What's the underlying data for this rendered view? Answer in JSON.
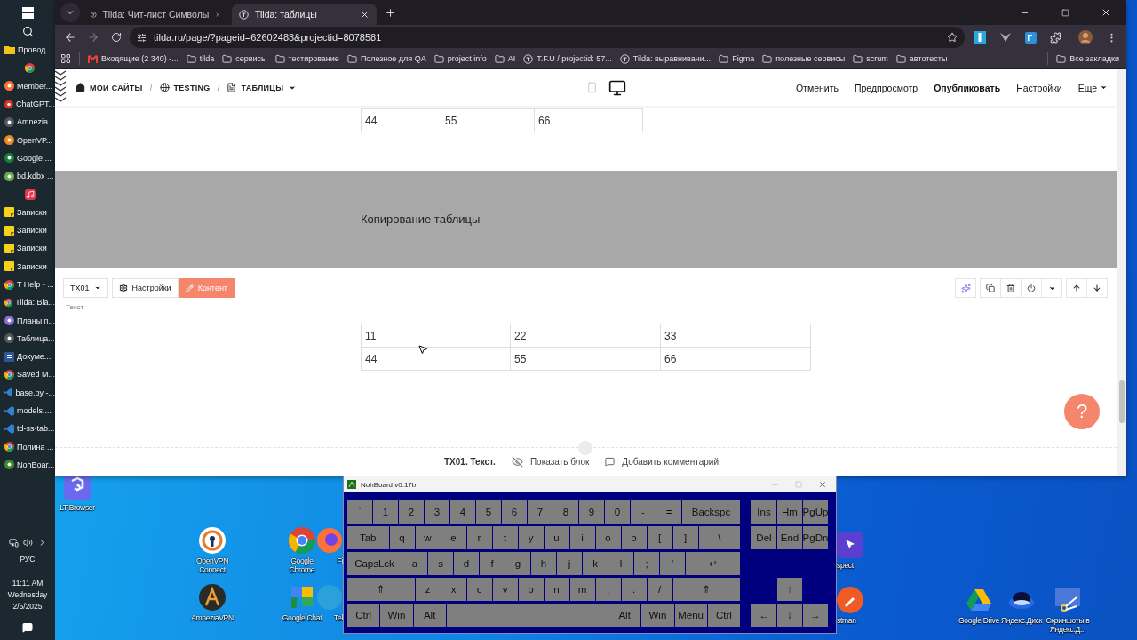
{
  "taskbar": {
    "items": [
      {
        "label": "Провод...",
        "kind": "folder"
      },
      {
        "kind": "chrome"
      },
      {
        "label": "Member...",
        "kind": "firefox"
      },
      {
        "label": "ChatGPT...",
        "kind": "red"
      },
      {
        "label": "Amnezia...",
        "kind": "dark"
      },
      {
        "label": "OpenVP...",
        "kind": "openvpn"
      },
      {
        "label": "Google ...",
        "kind": "green"
      },
      {
        "label": "bd.kdbx ...",
        "kind": "keepass"
      },
      {
        "kind": "music"
      },
      {
        "label": "Записки",
        "kind": "note"
      },
      {
        "label": "Записки",
        "kind": "note"
      },
      {
        "label": "Записки",
        "kind": "note"
      },
      {
        "label": "Записки",
        "kind": "note"
      },
      {
        "label": "T Help - ...",
        "kind": "chrome"
      },
      {
        "label": "Tilda: Bla...",
        "kind": "chrome"
      },
      {
        "label": "Планы п...",
        "kind": "purple"
      },
      {
        "label": "Таблица...",
        "kind": "dark"
      },
      {
        "label": "Докуме...",
        "kind": "word"
      },
      {
        "label": "Saved M...",
        "kind": "chrome"
      },
      {
        "label": "base.py -...",
        "kind": "code"
      },
      {
        "label": "models....",
        "kind": "code"
      },
      {
        "label": "td-ss-tab...",
        "kind": "code"
      },
      {
        "label": "Полина ...",
        "kind": "chrome"
      },
      {
        "label": "NohBoar...",
        "kind": "keyboard"
      }
    ],
    "tray": {
      "language": "РУС",
      "time": "11:11 AM",
      "day": "Wednesday",
      "date": "2/5/2025"
    }
  },
  "browser": {
    "tabs": [
      {
        "title": "Tilda: Чит-лист Символы",
        "selected": false
      },
      {
        "title": "Tilda: таблицы",
        "selected": true
      }
    ],
    "url": "tilda.ru/page/?pageid=62602483&projectid=8078581",
    "bookmarks": [
      {
        "label": "Входящие (2 340) -...",
        "kind": "mail"
      },
      {
        "label": "tilda",
        "kind": "folder"
      },
      {
        "label": "сервисы",
        "kind": "folder"
      },
      {
        "label": "тестирование",
        "kind": "folder"
      },
      {
        "label": "Полезное для QA",
        "kind": "folder"
      },
      {
        "label": "project info",
        "kind": "folder"
      },
      {
        "label": "AI",
        "kind": "folder"
      },
      {
        "label": "T.F.U / projectid: 57...",
        "kind": "site"
      },
      {
        "label": "Tilda: выравнивани...",
        "kind": "site"
      },
      {
        "label": "Figma",
        "kind": "folder"
      },
      {
        "label": "полезные сервисы",
        "kind": "folder"
      },
      {
        "label": "scrum",
        "kind": "folder"
      },
      {
        "label": "автотесты",
        "kind": "folder"
      }
    ],
    "all_bookmarks": "Все закладки"
  },
  "editor": {
    "breadcrumbs": [
      {
        "label": "МОИ САЙТЫ",
        "kind": "home"
      },
      {
        "label": "/",
        "kind": "separator"
      },
      {
        "label": "TESTING",
        "kind": "site"
      },
      {
        "label": "/",
        "kind": "separator"
      },
      {
        "label": "ТАБЛИЦЫ",
        "kind": "page"
      }
    ],
    "devices": [
      {
        "kind": "mobile",
        "selected": false
      },
      {
        "kind": "desktop",
        "selected": true
      }
    ],
    "actions": [
      {
        "label": "Отменить",
        "primary": false,
        "dropdown": false
      },
      {
        "label": "Предпросмотр",
        "primary": false,
        "dropdown": false
      },
      {
        "label": "Опубликовать",
        "primary": true,
        "dropdown": false
      },
      {
        "label": "Настройки",
        "primary": false,
        "dropdown": false
      },
      {
        "label": "Еще",
        "primary": false,
        "dropdown": true
      }
    ],
    "top_table": {
      "rows": [
        [
          "44",
          "55",
          "66"
        ]
      ]
    },
    "cover": {
      "title": "Копирование таблицы"
    },
    "block": {
      "code": "TX01",
      "settings": "Настройки",
      "content": "Контент",
      "label": "Текст",
      "table": {
        "rows": [
          [
            "11",
            "22",
            "33"
          ],
          [
            "44",
            "55",
            "66"
          ]
        ]
      }
    },
    "footer": {
      "title": "TX01. Текст.",
      "show_block": "Показать блок",
      "comment": "Добавить комментарий"
    },
    "help": "?"
  },
  "desktop_icons": [
    {
      "label": "LT Browser",
      "kind": "lt"
    },
    {
      "label": "OpenVPN Connect",
      "kind": "openvpn"
    },
    {
      "label": "Google Chrome",
      "kind": "chrome"
    },
    {
      "label": "Fi",
      "kind": "firefox"
    },
    {
      "label": "AmneziaVPN",
      "kind": "amnezia"
    },
    {
      "label": "Google Chat",
      "kind": "chat"
    },
    {
      "label": "Tel",
      "kind": "telegram"
    },
    {
      "label": "spect",
      "kind": "inspect"
    },
    {
      "label": "stman",
      "kind": "postman"
    },
    {
      "label": "Google Drive",
      "kind": "drive"
    },
    {
      "label": "Яндекс.Диск",
      "kind": "disk"
    },
    {
      "label": "Скриншоты в Яндекс.Д...",
      "kind": "scissors"
    }
  ],
  "keyboard": {
    "title": "NohBoard v0.17b",
    "rows": [
      {
        "keys": [
          "`",
          "1",
          "2",
          "3",
          "4",
          "5",
          "6",
          "7",
          "8",
          "9",
          "0",
          "-",
          "=",
          {
            "label": "Backspc",
            "kind": "wide"
          }
        ]
      },
      {
        "keys": [
          {
            "label": "Tab",
            "kind": "wide"
          },
          "q",
          "w",
          "e",
          "r",
          "t",
          "y",
          "u",
          "i",
          "o",
          "p",
          "[",
          "]",
          {
            "label": "\\",
            "kind": "wide"
          }
        ]
      },
      {
        "keys": [
          {
            "label": "CapsLck",
            "kind": "wide"
          },
          "a",
          "s",
          "d",
          "f",
          "g",
          "h",
          "j",
          "k",
          "l",
          ";",
          "'",
          {
            "label": "↵",
            "kind": "wide"
          }
        ]
      },
      {
        "keys": [
          {
            "label": "⇑",
            "kind": "wide"
          },
          "z",
          "x",
          "c",
          "v",
          "b",
          "n",
          "m",
          ",",
          ".",
          "/",
          {
            "label": "⇑",
            "kind": "wide"
          }
        ]
      },
      {
        "keys": [
          {
            "label": "Ctrl",
            "kind": "wide"
          },
          {
            "label": "Win",
            "kind": "wide"
          },
          {
            "label": "Alt",
            "kind": "wide"
          },
          {
            "kind": "space"
          },
          {
            "label": "Alt",
            "kind": "wide"
          },
          {
            "label": "Win",
            "kind": "wide"
          },
          {
            "label": "Menu",
            "kind": "wide"
          },
          {
            "label": "Ctrl",
            "kind": "wide"
          }
        ]
      }
    ],
    "nav_rows": [
      {
        "keys": [
          "Ins",
          "Hm",
          "PgUp"
        ]
      },
      {
        "keys": [
          "Del",
          "End",
          "PgDn"
        ]
      },
      {
        "keys": [
          {
            "kind": "gap"
          },
          {
            "kind": "gap"
          },
          {
            "kind": "gap"
          }
        ]
      },
      {
        "keys": [
          {
            "kind": "gap"
          },
          "↑",
          {
            "kind": "gap"
          }
        ]
      },
      {
        "keys": [
          "←",
          "↓",
          "→"
        ]
      }
    ]
  }
}
